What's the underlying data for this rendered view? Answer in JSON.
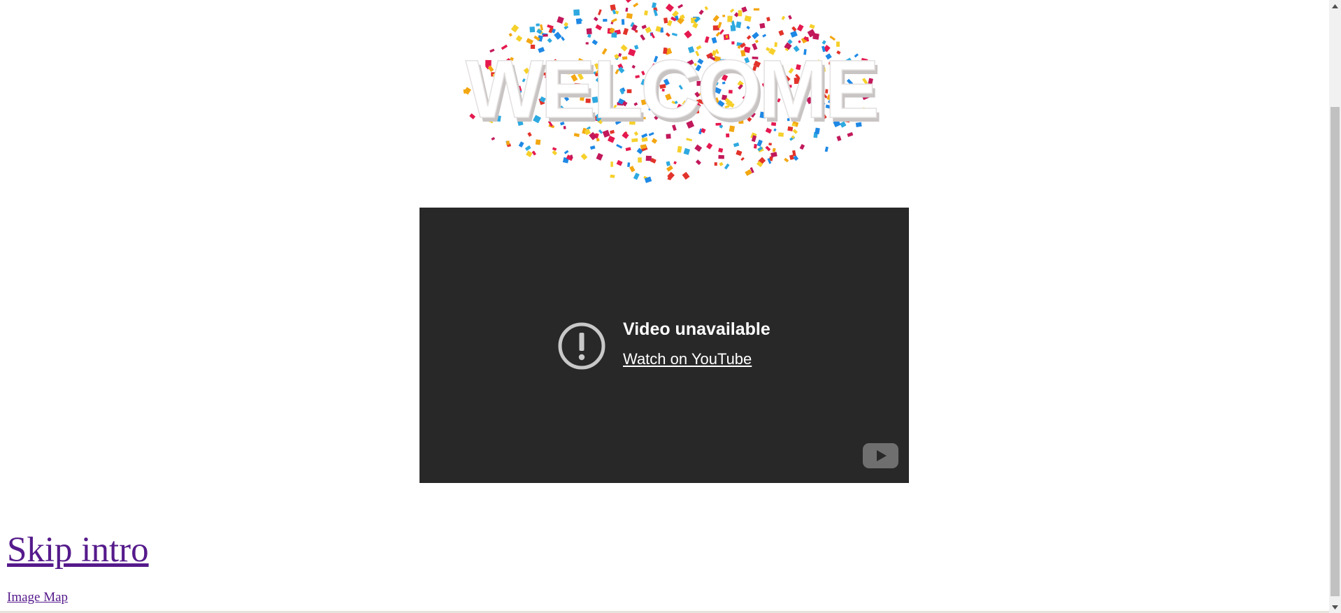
{
  "banner": {
    "alt": "WELCOME",
    "text": "WELCOME"
  },
  "video": {
    "title": "Video unavailable",
    "watch_link": "Watch on YouTube",
    "icons": {
      "error": "alert-circle-icon",
      "logo": "youtube-logo-icon"
    },
    "colors": {
      "background": "#282828",
      "text": "#ffffff",
      "icon": "#c8c8c8"
    }
  },
  "links": {
    "skip_intro": "Skip intro",
    "image_map": "Image Map",
    "visited_color": "#551a8b"
  },
  "scrollbar": {
    "icons": [
      "scroll-up-arrow-icon",
      "scroll-down-arrow-icon"
    ]
  }
}
